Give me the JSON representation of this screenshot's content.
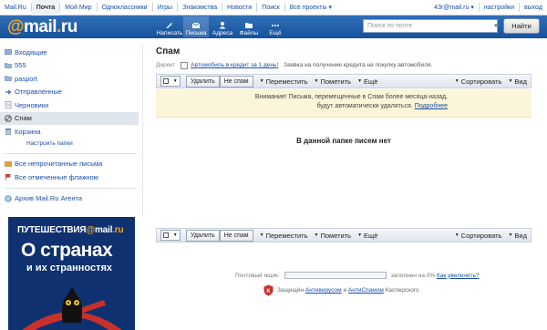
{
  "topbar": {
    "links": [
      "Mail.Ru",
      "Почта",
      "Мой Мир",
      "Одноклассники",
      "Игры",
      "Знакомства",
      "Новости",
      "Поиск",
      "Все проекты ▾"
    ],
    "user": "43r@mail.ru ▾",
    "settings": "настройки",
    "logout": "выход"
  },
  "header": {
    "logo_at": "@",
    "logo_text": "mail",
    "logo_dot": ".",
    "logo_tld": "ru",
    "nav": [
      "Написать",
      "Письма",
      "Адреса",
      "Файлы",
      "Ещё"
    ],
    "search_placeholder": "Поиск по почте",
    "search_button": "Найти"
  },
  "sidebar": {
    "folders": [
      "Входящие",
      "555",
      "pasport",
      "Отправленные",
      "Черновики",
      "Спам",
      "Корзина"
    ],
    "configure": "Настроить папки",
    "filters": [
      "Все непрочитанные письма",
      "Все отмеченные флажком"
    ],
    "archive": "Архив Mail.Ru Агента"
  },
  "ad": {
    "brand_a": "ПУТЕШЕСТВИЯ",
    "brand_at": "@",
    "brand_b": "mail",
    "brand_c": ".ru",
    "h1": "О странах",
    "h2": "и их странностях"
  },
  "main": {
    "title": "Спам",
    "promo_label": "Директ",
    "promo_link": "Автомобиль в кредит за 1 день!",
    "promo_text": "Заявка на получение кредита на покупку автомобиля.",
    "toolbar": {
      "delete": "Удалить",
      "not_spam": "Не спам",
      "move": "Переместить",
      "mark": "Пометить",
      "more": "Ещё",
      "sort": "Сортировать",
      "view": "Вид"
    },
    "warning_line1": "Внимание! Письма, перемещенные в Спам более месяца назад,",
    "warning_line2": "будут автоматически удаляться.",
    "warning_link": "Подробнее",
    "empty": "В данной папке писем нет"
  },
  "footer": {
    "quota_label": "Почтовый ящик:",
    "quota_text": "заполнен на 0%",
    "quota_link": "Как увеличить?",
    "quota_fill": 0,
    "av_text1": "Защищён",
    "av_link1": "Антивирусом",
    "av_and": "и",
    "av_link2": "АнтиСпамом",
    "av_text2": "Касперского"
  },
  "colors": {
    "header": "#1f5fa8",
    "accent": "#f6a821",
    "warning_bg": "#fbf5d9",
    "selected": "#dfe5ec"
  }
}
